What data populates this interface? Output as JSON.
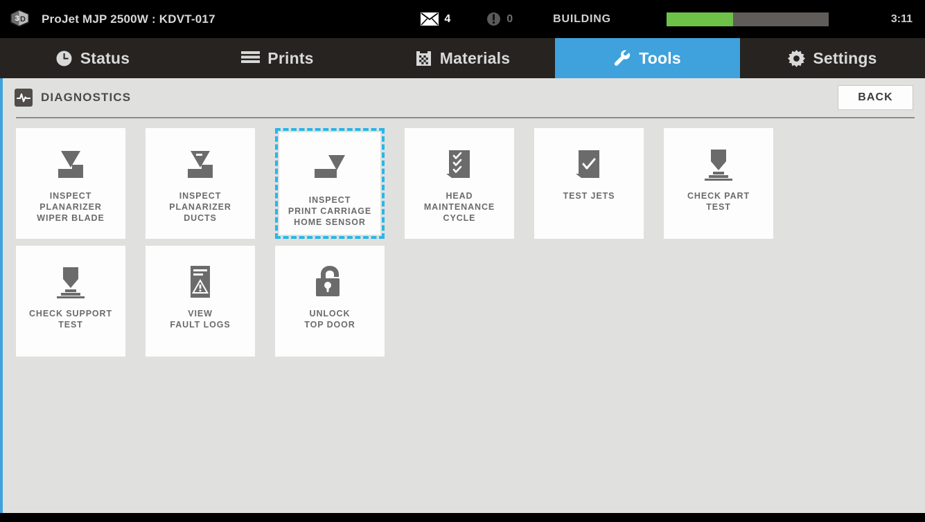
{
  "titlebar": {
    "logo_icon": "3d-systems-cube-logo",
    "machine_title": "ProJet MJP 2500W : KDVT-017",
    "mail_icon": "envelope-icon",
    "mail_count": "4",
    "alert_icon": "alert-exclamation-icon",
    "alert_count": "0",
    "build_state": "BUILDING",
    "progress_percent": 41,
    "progress_fill_color": "#6ec148",
    "progress_track_color": "#5f5c59",
    "clock": "3:11"
  },
  "nav": {
    "active_tab": "Tools",
    "active_color": "#3fa2dc",
    "tabs": [
      {
        "label": "Status",
        "icon": "clock-icon",
        "active": false
      },
      {
        "label": "Prints",
        "icon": "list-lines-icon",
        "active": false
      },
      {
        "label": "Materials",
        "icon": "grid-bucket-icon",
        "active": false
      },
      {
        "label": "Tools",
        "icon": "wrench-icon",
        "active": true
      },
      {
        "label": "Settings",
        "icon": "gear-icon",
        "active": false
      }
    ]
  },
  "subheader": {
    "icon": "heartbeat-pulse-icon",
    "title": "DIAGNOSTICS",
    "back_label": "BACK"
  },
  "tiles": [
    {
      "line1": "INSPECT",
      "line2": "PLANARIZER",
      "line3": "WIPER BLADE",
      "icon": "planarizer-blade-icon",
      "selected": false
    },
    {
      "line1": "INSPECT",
      "line2": "PLANARIZER",
      "line3": "DUCTS",
      "icon": "planarizer-ducts-icon",
      "selected": false
    },
    {
      "line1": "INSPECT",
      "line2": "PRINT CARRIAGE",
      "line3": "HOME SENSOR",
      "icon": "carriage-home-sensor-icon",
      "selected": true
    },
    {
      "line1": "HEAD",
      "line2": "MAINTENANCE",
      "line3": "CYCLE",
      "icon": "checklist-three-icon",
      "selected": false
    },
    {
      "line1": "TEST JETS",
      "line2": "",
      "line3": "",
      "icon": "checklist-one-icon",
      "selected": false
    },
    {
      "line1": "CHECK PART",
      "line2": "TEST",
      "line3": "",
      "icon": "nozzle-part-icon",
      "selected": false
    },
    {
      "line1": "CHECK SUPPORT",
      "line2": "TEST",
      "line3": "",
      "icon": "nozzle-support-icon",
      "selected": false
    },
    {
      "line1": "VIEW",
      "line2": "FAULT LOGS",
      "line3": "",
      "icon": "fault-log-icon",
      "selected": false
    },
    {
      "line1": "UNLOCK",
      "line2": "TOP DOOR",
      "line3": "",
      "icon": "open-padlock-icon",
      "selected": false
    }
  ]
}
